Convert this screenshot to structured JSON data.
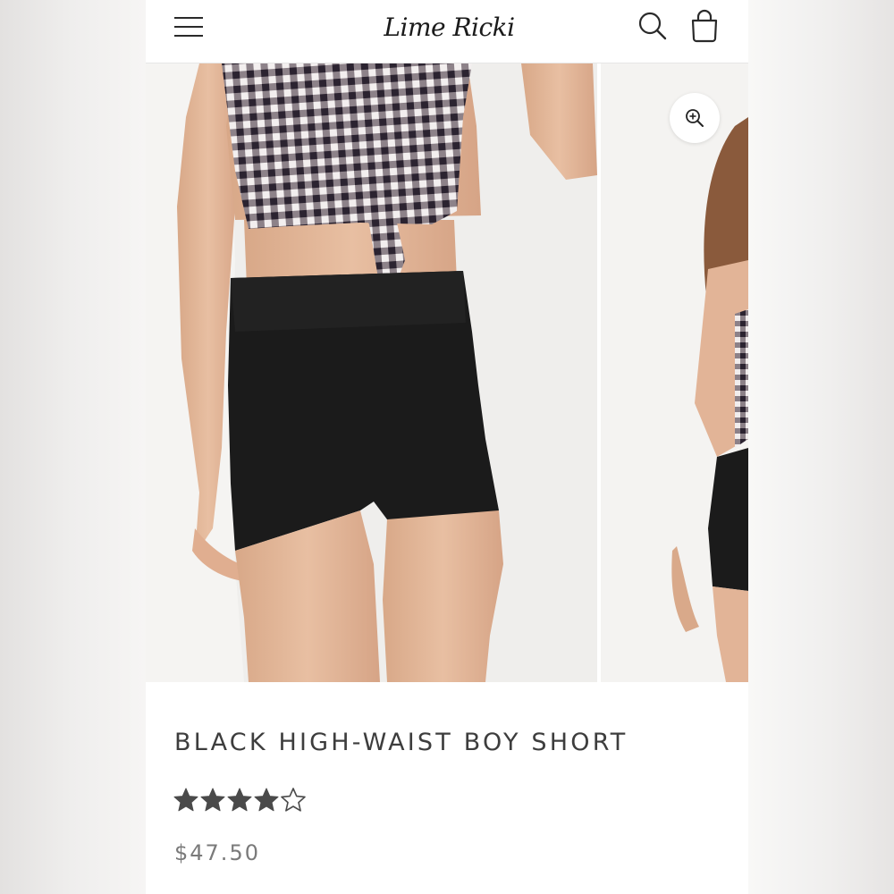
{
  "header": {
    "logo_text": "Lime Ricki",
    "menu_icon": "hamburger-menu-icon",
    "search_icon": "search-icon",
    "cart_icon": "shopping-bag-icon"
  },
  "gallery": {
    "zoom_icon": "zoom-in-icon"
  },
  "product": {
    "title": "BLACK HIGH-WAIST BOY SHORT",
    "rating": 4,
    "rating_max": 5,
    "price": "$47.50"
  },
  "colors": {
    "text_dark": "#3d3d3d",
    "price_gray": "#7a7a7a",
    "star_fill": "#4a4a4a"
  }
}
